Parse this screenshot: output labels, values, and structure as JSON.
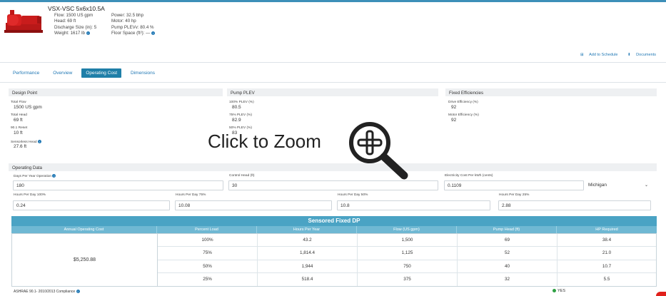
{
  "product": {
    "title": "VSX-VSC 5x6x10.5A",
    "specs_left": [
      "Flow: 1500 US gpm",
      "Head: 69 ft",
      "Discharge Size (in): 5",
      "Weight: 1617 lb"
    ],
    "specs_right": [
      "Power: 32.5 bhp",
      "Motor: 40 hp",
      "Pump PLEVv: 80.4 %",
      "Floor Space (ft²): —"
    ]
  },
  "links": {
    "add_schedule": "Add to Schedule",
    "documents": "Documents"
  },
  "tabs": [
    {
      "label": "Performance",
      "active": false
    },
    {
      "label": "Overview",
      "active": false
    },
    {
      "label": "Operating Cost",
      "active": true
    },
    {
      "label": "Dimensions",
      "active": false
    }
  ],
  "design_point": {
    "header": "Design Point",
    "fields": [
      {
        "label": "Total Flow",
        "value": "1500 US gpm"
      },
      {
        "label": "Total Head",
        "value": "69 ft"
      },
      {
        "label": "90.1 Reset",
        "value": "10 ft"
      },
      {
        "label": "Sensorless Head",
        "value": "27.6 ft"
      }
    ]
  },
  "pump_plev": {
    "header": "Pump PLEV",
    "fields": [
      {
        "label": "100% PLEV (%)",
        "value": "80.5"
      },
      {
        "label": "75% PLEV (%)",
        "value": "82.9"
      },
      {
        "label": "50% PLEV (%)",
        "value": "83"
      }
    ]
  },
  "fixed_eff": {
    "header": "Fixed Efficiencies",
    "fields": [
      {
        "label": "Drive Efficiency (%)",
        "value": "92"
      },
      {
        "label": "Motor Efficiency (%)",
        "value": "92"
      }
    ]
  },
  "operating_data": {
    "header": "Operating Data",
    "days_label": "Days Per Year Operation",
    "days_value": "180",
    "control_head_label": "Control Head (ft)",
    "control_head_value": "30",
    "elec_label": "Electricity Cost Per kWh (cents)",
    "elec_value": "0.1109",
    "state_value": "Michigan",
    "hours": [
      {
        "label": "Hours Per Day 100%",
        "value": "0.24"
      },
      {
        "label": "Hours Per Day 75%",
        "value": "10.08"
      },
      {
        "label": "Hours Per Day 50%",
        "value": "10.8"
      },
      {
        "label": "Hours Per Day 25%",
        "value": "2.88"
      }
    ]
  },
  "table": {
    "title": "Sensored Fixed DP",
    "columns": [
      "Annual Operating Cost",
      "Percent Load",
      "Hours Per Year",
      "Flow (US gpm)",
      "Pump Head (ft)",
      "HP Required"
    ],
    "annual_cost": "$5,250.88",
    "rows": [
      [
        "100%",
        "43.2",
        "1,500",
        "69",
        "38.4"
      ],
      [
        "75%",
        "1,814.4",
        "1,125",
        "52",
        "21.0"
      ],
      [
        "50%",
        "1,944",
        "750",
        "40",
        "10.7"
      ],
      [
        "25%",
        "518.4",
        "375",
        "32",
        "5.5"
      ]
    ]
  },
  "footer": {
    "compliance_label": "ASHRAE 90.1- 2010/2013 Compliance",
    "compliance_value": "YES"
  },
  "overlay": {
    "zoom_text": "Click to Zoom"
  },
  "colors": {
    "accent": "#1f7fa8",
    "table_header": "#4aa3c4",
    "pump_red": "#d62020"
  }
}
